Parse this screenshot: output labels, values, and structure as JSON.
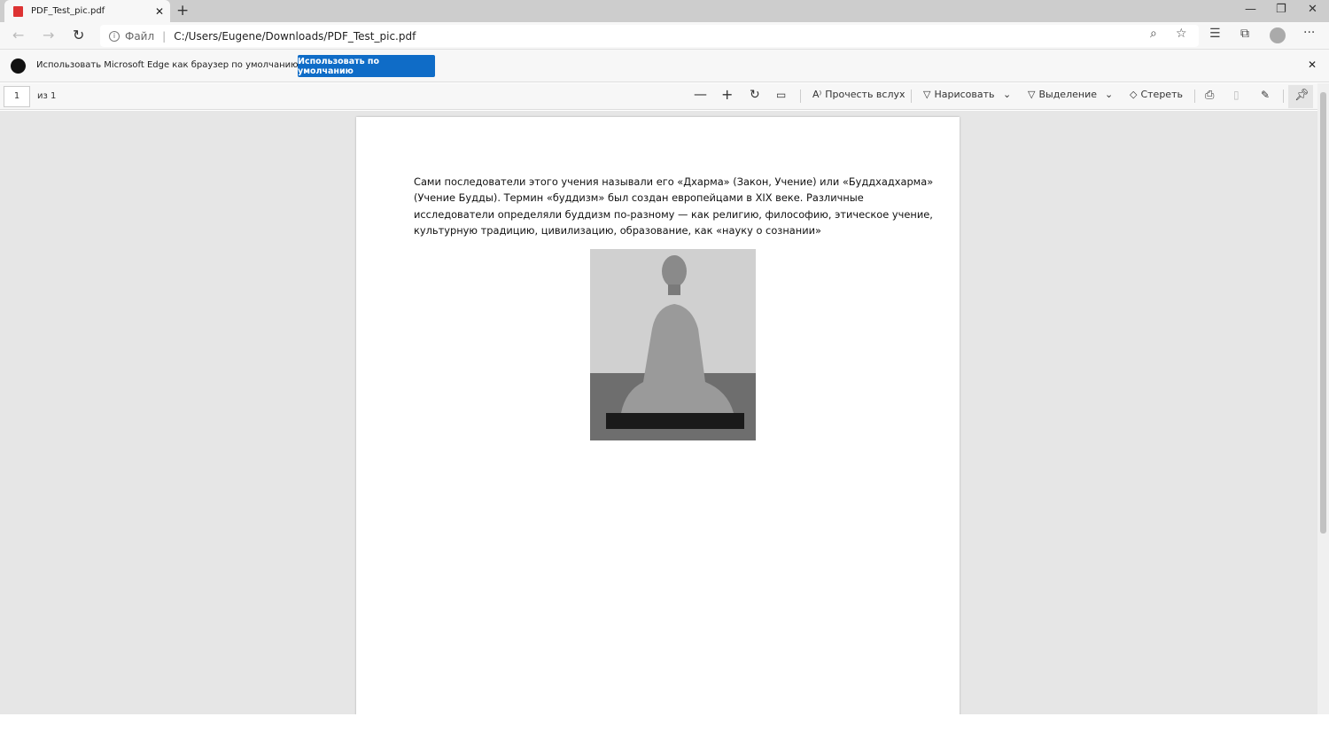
{
  "tab": {
    "title": "PDF_Test_pic.pdf",
    "pdf_icon": "PDF"
  },
  "address": {
    "scheme": "Файл",
    "url": "C:/Users/Eugene/Downloads/PDF_Test_pic.pdf"
  },
  "infobar": {
    "message": "Использовать Microsoft Edge как браузер по умолчанию?",
    "button": "Использовать по умолчанию"
  },
  "pdf_toolbar": {
    "page": "1",
    "of": "из 1",
    "read_aloud": "Прочесть вслух",
    "draw": "Нарисовать",
    "highlight": "Выделение",
    "erase": "Стереть"
  },
  "document": {
    "paragraph": "Сами последователи этого учения называли его «Дхарма» (Закон, Учение) или «Буддхадхарма» (Учение Будды). Термин «буддизм» был создан европейцами в XIX веке. Различные исследователи определяли буддизм по-разному — как религию, философию, этическое учение, культурную традицию, цивилизацию, образование, как «науку о сознании»"
  },
  "colors": {
    "accent": "#0f6cc7"
  }
}
